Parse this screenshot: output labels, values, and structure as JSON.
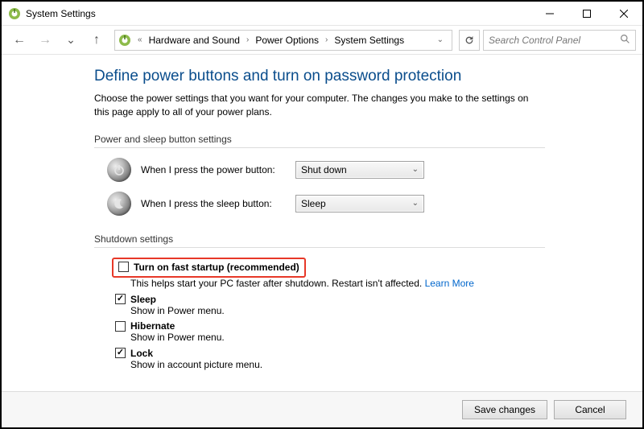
{
  "window": {
    "title": "System Settings"
  },
  "breadcrumb": {
    "root_glyph": "«",
    "items": [
      "Hardware and Sound",
      "Power Options",
      "System Settings"
    ]
  },
  "search": {
    "placeholder": "Search Control Panel"
  },
  "page": {
    "title": "Define power buttons and turn on password protection",
    "desc": "Choose the power settings that you want for your computer. The changes you make to the settings on this page apply to all of your power plans."
  },
  "sections": {
    "power_sleep": "Power and sleep button settings",
    "shutdown": "Shutdown settings"
  },
  "power_button": {
    "label": "When I press the power button:",
    "value": "Shut down"
  },
  "sleep_button": {
    "label": "When I press the sleep button:",
    "value": "Sleep"
  },
  "shutdown_items": {
    "fast_startup": {
      "checked": false,
      "label": "Turn on fast startup (recommended)",
      "sub_before": "This helps start your PC faster after shutdown. Restart isn't affected. ",
      "learn_more": "Learn More"
    },
    "sleep": {
      "checked": true,
      "label": "Sleep",
      "sub": "Show in Power menu."
    },
    "hibernate": {
      "checked": false,
      "label": "Hibernate",
      "sub": "Show in Power menu."
    },
    "lock": {
      "checked": true,
      "label": "Lock",
      "sub": "Show in account picture menu."
    }
  },
  "footer": {
    "save": "Save changes",
    "cancel": "Cancel"
  }
}
